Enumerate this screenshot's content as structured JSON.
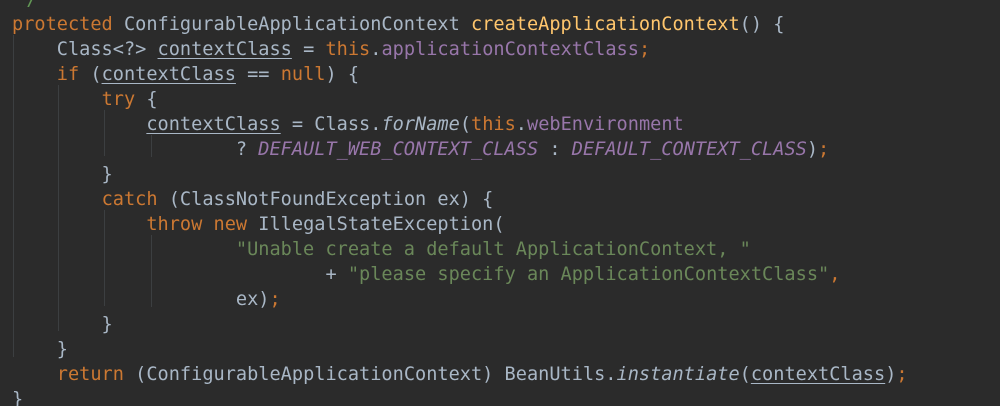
{
  "editor": {
    "theme_colors": {
      "background": "#2b2b2b",
      "text": "#a9b7c6",
      "keyword": "#cc7832",
      "method_declaration": "#ffc66d",
      "field": "#9876aa",
      "string": "#6a8759",
      "comment": "#629755"
    },
    "lines": [
      {
        "name": "code-line-0",
        "tokens": [
          {
            "t": " */",
            "c": "cmt"
          }
        ]
      },
      {
        "name": "code-line-1",
        "tokens": [
          {
            "t": "protected",
            "c": "kw"
          },
          {
            "t": " ConfigurableApplicationContext ",
            "c": "id"
          },
          {
            "t": "createApplicationContext",
            "c": "fn"
          },
          {
            "t": "() {",
            "c": "id"
          }
        ]
      },
      {
        "name": "code-line-2",
        "tokens": [
          {
            "t": "    Class<?> ",
            "c": "id"
          },
          {
            "t": "contextClass",
            "c": "id ul"
          },
          {
            "t": " = ",
            "c": "id"
          },
          {
            "t": "this",
            "c": "kw"
          },
          {
            "t": ".",
            "c": "id"
          },
          {
            "t": "applicationContextClass",
            "c": "fld"
          },
          {
            "t": ";",
            "c": "kw"
          }
        ]
      },
      {
        "name": "code-line-3",
        "tokens": [
          {
            "t": "    ",
            "c": "id"
          },
          {
            "t": "if",
            "c": "kw"
          },
          {
            "t": " (",
            "c": "id"
          },
          {
            "t": "contextClass",
            "c": "id ul"
          },
          {
            "t": " == ",
            "c": "id"
          },
          {
            "t": "null",
            "c": "kw"
          },
          {
            "t": ") {",
            "c": "id"
          }
        ]
      },
      {
        "name": "code-line-4",
        "tokens": [
          {
            "t": "        ",
            "c": "id"
          },
          {
            "t": "try",
            "c": "kw"
          },
          {
            "t": " {",
            "c": "id"
          }
        ]
      },
      {
        "name": "code-line-5",
        "tokens": [
          {
            "t": "            ",
            "c": "id"
          },
          {
            "t": "contextClass",
            "c": "id ul"
          },
          {
            "t": " = Class.",
            "c": "id"
          },
          {
            "t": "forName",
            "c": "id ital"
          },
          {
            "t": "(",
            "c": "id"
          },
          {
            "t": "this",
            "c": "kw"
          },
          {
            "t": ".",
            "c": "id"
          },
          {
            "t": "webEnvironment",
            "c": "fld"
          }
        ]
      },
      {
        "name": "code-line-6",
        "tokens": [
          {
            "t": "                    ? ",
            "c": "id"
          },
          {
            "t": "DEFAULT_WEB_CONTEXT_CLASS",
            "c": "cst"
          },
          {
            "t": " : ",
            "c": "id"
          },
          {
            "t": "DEFAULT_CONTEXT_CLASS",
            "c": "cst"
          },
          {
            "t": ")",
            "c": "id"
          },
          {
            "t": ";",
            "c": "kw"
          }
        ]
      },
      {
        "name": "code-line-7",
        "tokens": [
          {
            "t": "        }",
            "c": "id"
          }
        ]
      },
      {
        "name": "code-line-8",
        "tokens": [
          {
            "t": "        ",
            "c": "id"
          },
          {
            "t": "catch",
            "c": "kw"
          },
          {
            "t": " (ClassNotFoundException ex) {",
            "c": "id"
          }
        ]
      },
      {
        "name": "code-line-9",
        "tokens": [
          {
            "t": "            ",
            "c": "id"
          },
          {
            "t": "throw new",
            "c": "kw"
          },
          {
            "t": " IllegalStateException(",
            "c": "id"
          }
        ]
      },
      {
        "name": "code-line-10",
        "tokens": [
          {
            "t": "                    ",
            "c": "id"
          },
          {
            "t": "\"Unable create a default ApplicationContext, \"",
            "c": "str"
          }
        ]
      },
      {
        "name": "code-line-11",
        "tokens": [
          {
            "t": "                            + ",
            "c": "id"
          },
          {
            "t": "\"please specify an ApplicationContextClass\"",
            "c": "str"
          },
          {
            "t": ",",
            "c": "kw"
          }
        ]
      },
      {
        "name": "code-line-12",
        "tokens": [
          {
            "t": "                    ex)",
            "c": "id"
          },
          {
            "t": ";",
            "c": "kw"
          }
        ]
      },
      {
        "name": "code-line-13",
        "tokens": [
          {
            "t": "        }",
            "c": "id"
          }
        ]
      },
      {
        "name": "code-line-14",
        "tokens": [
          {
            "t": "    }",
            "c": "id"
          }
        ]
      },
      {
        "name": "code-line-15",
        "tokens": [
          {
            "t": "    ",
            "c": "id"
          },
          {
            "t": "return",
            "c": "kw"
          },
          {
            "t": " (ConfigurableApplicationContext) BeanUtils.",
            "c": "id"
          },
          {
            "t": "instantiate",
            "c": "id ital"
          },
          {
            "t": "(",
            "c": "id"
          },
          {
            "t": "contextClass",
            "c": "id ul"
          },
          {
            "t": ")",
            "c": "id"
          },
          {
            "t": ";",
            "c": "kw"
          }
        ]
      },
      {
        "name": "code-line-16",
        "tokens": [
          {
            "t": "}",
            "c": "id"
          }
        ]
      }
    ]
  }
}
